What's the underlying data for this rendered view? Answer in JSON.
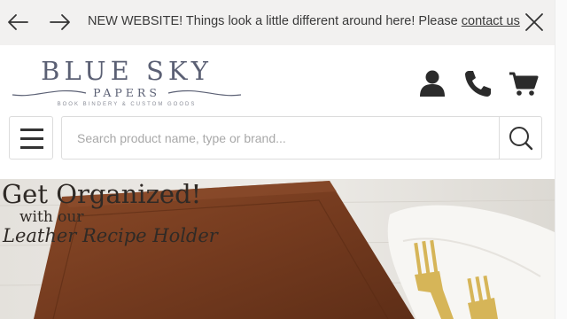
{
  "announcement": {
    "back_icon": "arrow-left-icon",
    "forward_icon": "arrow-right-icon",
    "text": "NEW WEBSITE!  Things look a little different around here! Please ",
    "link": "contact us",
    "close_icon": "close-icon"
  },
  "logo": {
    "name": "BLUE SKY",
    "sub": "PAPERS",
    "tagline": "Book Bindery & Custom Goods"
  },
  "header_icons": [
    "account-icon",
    "phone-icon",
    "cart-icon"
  ],
  "search": {
    "placeholder": "Search product name, type or brand...",
    "value": ""
  },
  "hero": {
    "line1": "Get Organized!",
    "line2": "with our",
    "line3": "Leather Recipe Holder"
  },
  "colors": {
    "announce_bg": "#f2f1f0",
    "logo": "#5b6074",
    "icon": "#2b2b2b",
    "leather": "#7a3f22"
  }
}
